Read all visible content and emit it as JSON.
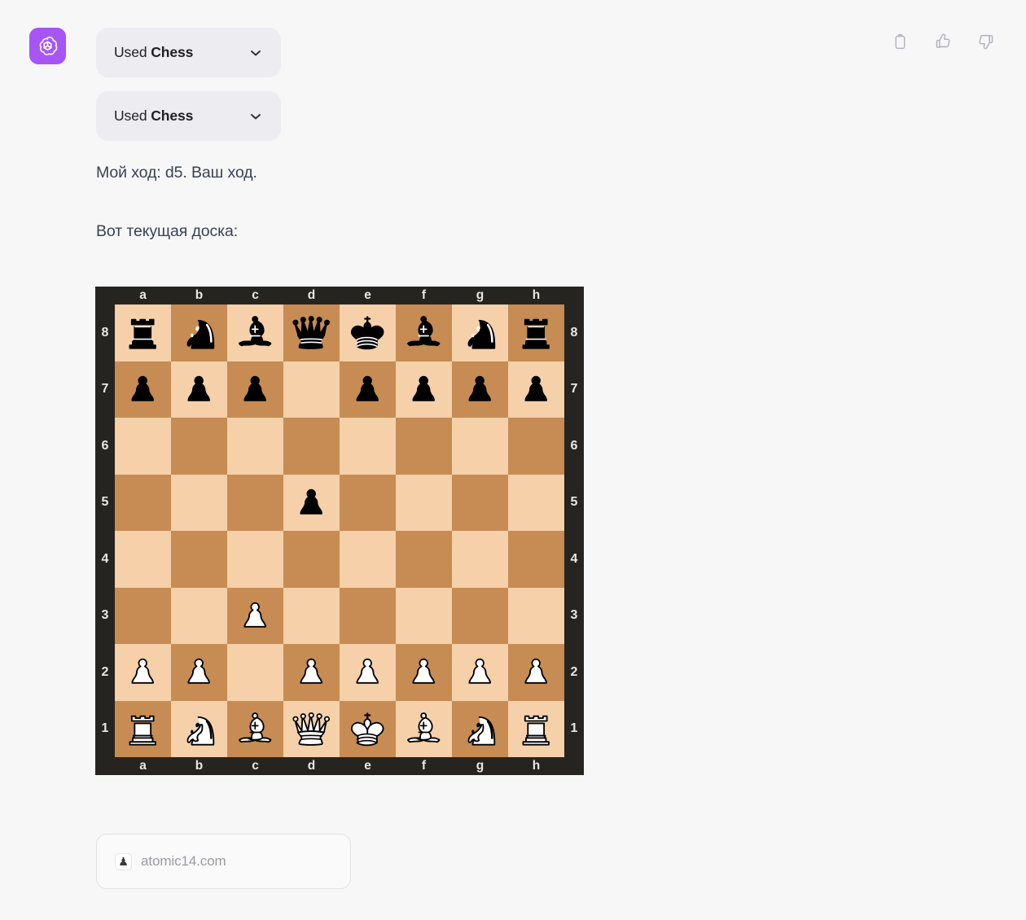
{
  "avatar": {
    "icon": "openai-logo-icon",
    "background_color": "#a855f7"
  },
  "tool_calls": [
    {
      "prefix": "Used ",
      "name": "Chess",
      "chevron_icon": "chevron-down-icon"
    },
    {
      "prefix": "Used ",
      "name": "Chess",
      "chevron_icon": "chevron-down-icon"
    }
  ],
  "message": {
    "paragraph_1": "Мой ход: d5. Ваш ход.",
    "paragraph_2": "Вот текущая доска:"
  },
  "actions": [
    {
      "name": "copy-button",
      "icon": "clipboard-icon"
    },
    {
      "name": "thumbs-up-button",
      "icon": "thumbs-up-icon"
    },
    {
      "name": "thumbs-down-button",
      "icon": "thumbs-down-icon"
    }
  ],
  "citation": {
    "favicon_icon": "chess-pawn-favicon",
    "label": "atomic14.com"
  },
  "board": {
    "files": [
      "a",
      "b",
      "c",
      "d",
      "e",
      "f",
      "g",
      "h"
    ],
    "ranks": [
      "8",
      "7",
      "6",
      "5",
      "4",
      "3",
      "2",
      "1"
    ],
    "light_square_color": "#f5d0a9",
    "dark_square_color": "#c68c53",
    "frame_color": "#262421",
    "coordinate_color": "#e8e8e6",
    "fen": "rnbqkbnr/ppp1pppp/8/3p4/8/2P5/PP1PPPPP/RNBQKBNR",
    "last_move": "d5",
    "position": [
      [
        "br",
        "bn",
        "bb",
        "bq",
        "bk",
        "bb",
        "bn",
        "br"
      ],
      [
        "bp",
        "bp",
        "bp",
        "",
        "bp",
        "bp",
        "bp",
        "bp"
      ],
      [
        "",
        "",
        "",
        "",
        "",
        "",
        "",
        ""
      ],
      [
        "",
        "",
        "",
        "bp",
        "",
        "",
        "",
        ""
      ],
      [
        "",
        "",
        "",
        "",
        "",
        "",
        "",
        ""
      ],
      [
        "",
        "",
        "wp",
        "",
        "",
        "",
        "",
        ""
      ],
      [
        "wp",
        "wp",
        "",
        "wp",
        "wp",
        "wp",
        "wp",
        "wp"
      ],
      [
        "wr",
        "wn",
        "wb",
        "wq",
        "wk",
        "wb",
        "wn",
        "wr"
      ]
    ]
  }
}
